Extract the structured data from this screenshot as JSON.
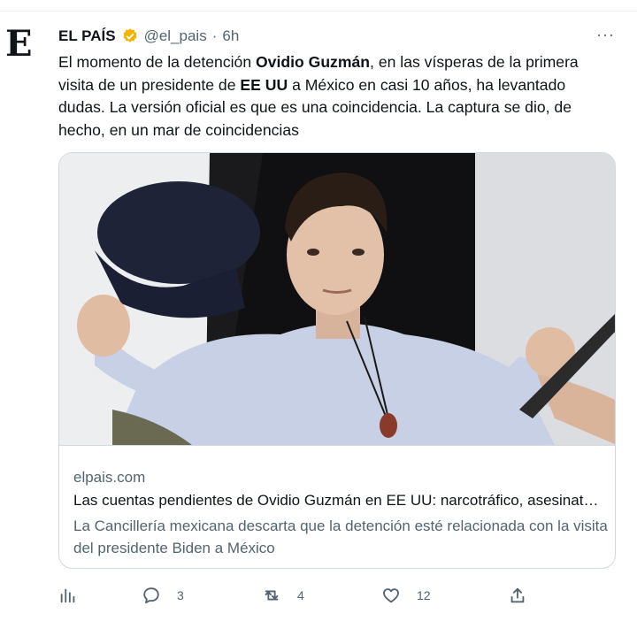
{
  "account": {
    "avatar_letter": "E",
    "name": "EL PAÍS",
    "handle": "@el_pais",
    "separator": "·",
    "time": "6h",
    "more_label": "···"
  },
  "tweet": {
    "t1": "El momento de la detención ",
    "b1": "Ovidio Guzmán",
    "t2": ", en las vísperas de la primera visita de un presidente de ",
    "b2": "EE UU",
    "t3": " a México en casi 10 años, ha levantado dudas. La versión oficial es que es una coincidencia. La captura se dio, de hecho, en un mar de coincidencias"
  },
  "card": {
    "domain": "elpais.com",
    "title": "Las cuentas pendientes de Ovidio Guzmán en EE UU: narcotráfico, asesinatos y lavado de dinero",
    "description": "La Cancillería mexicana descarta que la detención esté relacionada con la visita del presidente Biden a México"
  },
  "actions": {
    "analytics_icon": "analytics-icon",
    "reply_count": "3",
    "retweet_count": "4",
    "like_count": "12",
    "share_icon": "share-icon"
  },
  "colors": {
    "verified": "#f4b400",
    "secondary_text": "#536471",
    "border": "#cfd9de"
  }
}
